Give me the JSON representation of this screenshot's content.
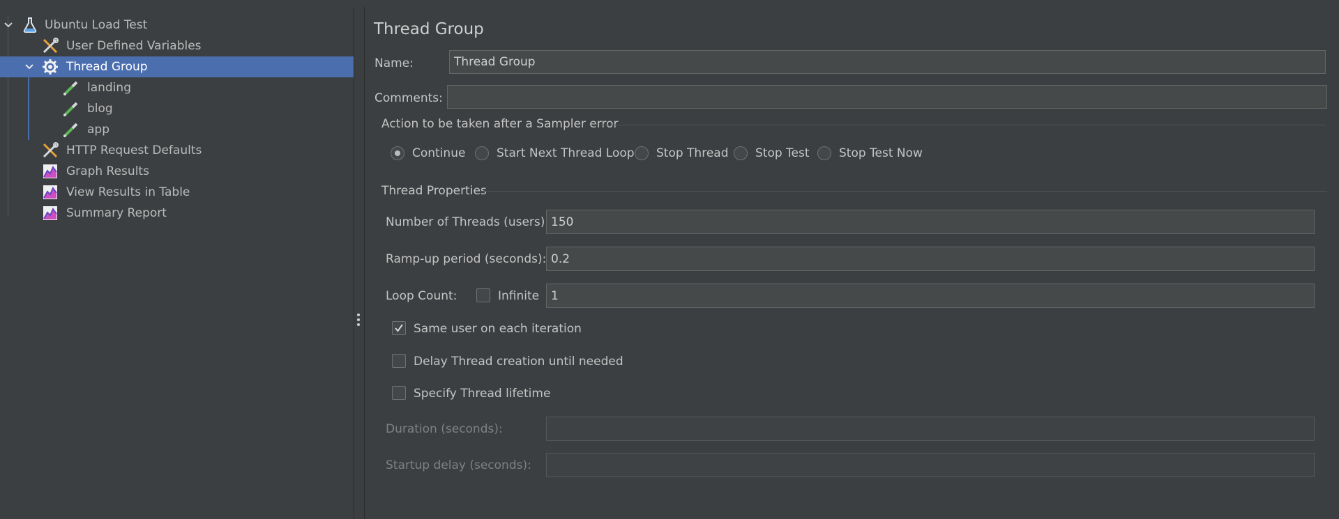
{
  "tree": {
    "items": [
      {
        "label": "Ubuntu Load Test",
        "icon": "flask-icon"
      },
      {
        "label": "User Defined Variables",
        "icon": "wrench-screwdriver-icon"
      },
      {
        "label": "Thread Group",
        "icon": "gear-icon"
      },
      {
        "label": "landing",
        "icon": "pipette-icon"
      },
      {
        "label": "blog",
        "icon": "pipette-icon"
      },
      {
        "label": "app",
        "icon": "pipette-icon"
      },
      {
        "label": "HTTP Request Defaults",
        "icon": "wrench-screwdriver-icon"
      },
      {
        "label": "Graph Results",
        "icon": "graph-icon"
      },
      {
        "label": "View Results in Table",
        "icon": "graph-icon"
      },
      {
        "label": "Summary Report",
        "icon": "graph-icon"
      }
    ],
    "selected": "Thread Group"
  },
  "panel": {
    "title": "Thread Group",
    "name_label": "Name:",
    "name_value": "Thread Group",
    "comments_label": "Comments:",
    "comments_value": "",
    "sampler_error": {
      "section": "Action to be taken after a Sampler error",
      "options": [
        "Continue",
        "Start Next Thread Loop",
        "Stop Thread",
        "Stop Test",
        "Stop Test Now"
      ],
      "selected": "Continue"
    },
    "thread_props": {
      "section": "Thread Properties",
      "threads_label": "Number of Threads (users):",
      "threads_value": "150",
      "rampup_label": "Ramp-up period (seconds):",
      "rampup_value": "0.2",
      "loop_label": "Loop Count:",
      "infinite_label": "Infinite",
      "infinite_checked": false,
      "loop_value": "1",
      "same_user_label": "Same user on each iteration",
      "same_user_checked": true,
      "delay_label": "Delay Thread creation until needed",
      "delay_checked": false,
      "lifetime_label": "Specify Thread lifetime",
      "lifetime_checked": false,
      "duration_label": "Duration (seconds):",
      "duration_value": "",
      "startup_label": "Startup delay (seconds):",
      "startup_value": ""
    }
  },
  "colors": {
    "background": "#3c3f41",
    "selection": "#4b6eaf",
    "field": "#45494a"
  }
}
